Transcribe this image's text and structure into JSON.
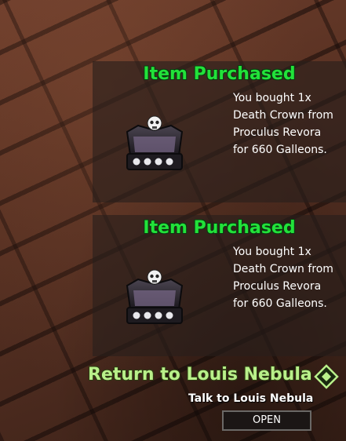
{
  "notifications": [
    {
      "title": "Item Purchased",
      "lines": [
        "You bought 1x",
        "Death Crown from",
        "Proculus Revora",
        "for 660 Galleons."
      ],
      "icon": "death-crown-icon"
    },
    {
      "title": "Item Purchased",
      "lines": [
        "You bought 1x",
        "Death Crown from",
        "Proculus Revora",
        "for 660 Galleons."
      ],
      "icon": "death-crown-icon"
    }
  ],
  "prompt": {
    "title": "Return to Louis Nebula",
    "subtitle": "Talk to Louis Nebula",
    "button_label": "OPEN",
    "icon": "diamond-quest-icon"
  },
  "colors": {
    "title_green": "#22e23a",
    "prompt_green": "#b9f08a",
    "panel_bg": "#28201c"
  }
}
